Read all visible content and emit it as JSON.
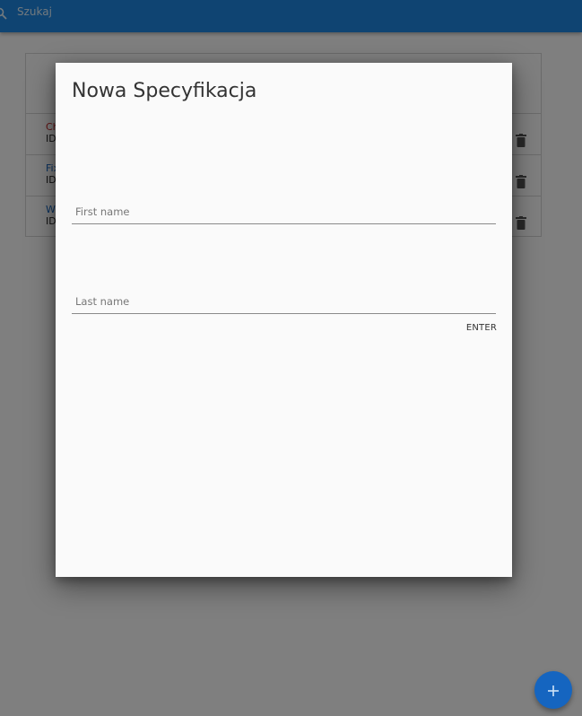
{
  "appbar": {
    "search_label": "Szukaj",
    "color": "#1e88e5"
  },
  "background_list": {
    "rows": [
      {
        "title": "Ch",
        "subtitle": "ID",
        "title_color": "#c62828"
      },
      {
        "title": "Fix",
        "subtitle": "ID",
        "title_color": "#1565c0"
      },
      {
        "title": "Wo",
        "subtitle": "ID",
        "title_color": "#1565c0"
      }
    ]
  },
  "dialog": {
    "title": "Nowa Specyfikacja",
    "first_name": {
      "value": "",
      "placeholder": "First name"
    },
    "last_name": {
      "value": "",
      "placeholder": "Last name"
    },
    "enter_label": "ENTER"
  },
  "fab": {
    "icon": "plus-icon",
    "color": "#1565c0"
  }
}
